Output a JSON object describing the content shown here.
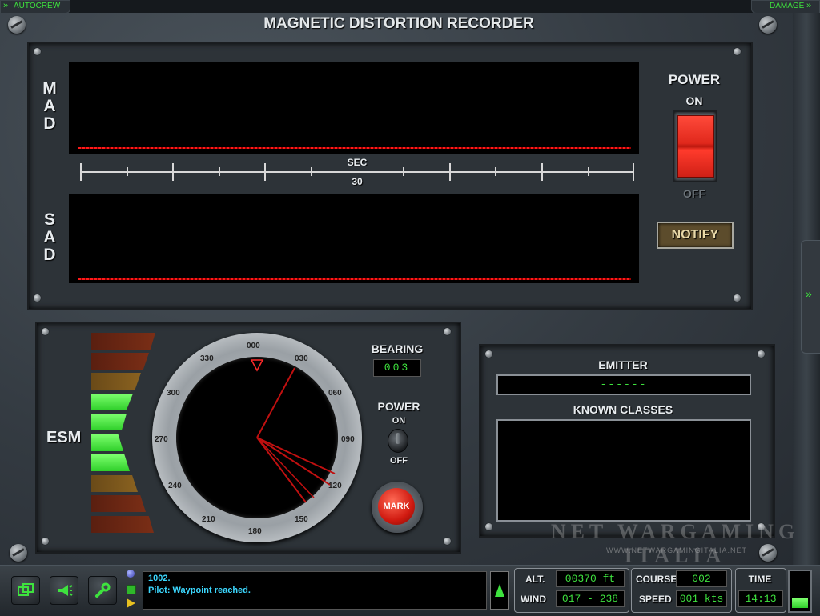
{
  "top_corners": {
    "left": "AUTOCREW",
    "right": "DAMAGE"
  },
  "mad_panel": {
    "title": "MAGNETIC DISTORTION RECORDER",
    "mad_label": [
      "M",
      "A",
      "D"
    ],
    "sad_label": [
      "S",
      "A",
      "D"
    ],
    "scale_unit": "SEC",
    "scale_value": "30",
    "power_label": "POWER",
    "power_on": "ON",
    "power_off": "OFF",
    "notify_label": "NOTIFY",
    "trace_color": "#ff1a1a"
  },
  "esm_panel": {
    "label": "ESM",
    "bearing_label": "BEARING",
    "bearing_value": "003",
    "power_label": "POWER",
    "power_on": "ON",
    "power_off": "OFF",
    "mark_label": "MARK",
    "esm_bars_active": [
      false,
      false,
      false,
      true,
      true,
      true,
      true,
      false,
      false,
      false
    ],
    "compass_labels": [
      "000",
      "030",
      "060",
      "090",
      "120",
      "150",
      "180",
      "210",
      "240",
      "270",
      "300",
      "330"
    ]
  },
  "emitter_panel": {
    "emitter_label": "EMITTER",
    "emitter_value": "------",
    "known_classes_label": "KNOWN CLASSES"
  },
  "watermark": {
    "title": "NET WARGAMING ITALIA",
    "url": "WWW.NETWARGAMINGITALIA.NET"
  },
  "status_bar": {
    "messages": [
      "1002.",
      "Pilot: Waypoint reached."
    ],
    "alt_label": "ALT.",
    "alt_value": "00370 ft",
    "wind_label": "WIND",
    "wind_value": "017 - 238",
    "course_label": "COURSE",
    "course_value": "002",
    "speed_label": "SPEED",
    "speed_value": "001 kts",
    "time_label": "TIME",
    "time_value": "14:13",
    "accent": "#3ee23e"
  }
}
